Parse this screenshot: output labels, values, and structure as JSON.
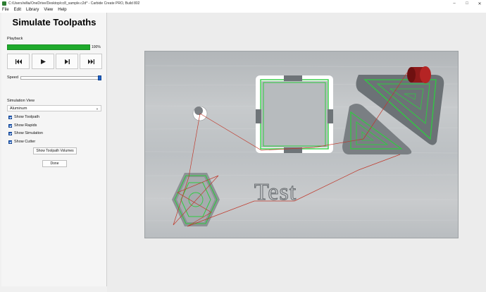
{
  "window": {
    "title": "C:/Users/wllia/OneDrive/Desktop/cc8_sample.c2d* - Carbide Create PRO, Build 802",
    "controls": [
      "–",
      "□",
      "✕"
    ]
  },
  "menu": {
    "items": [
      "File",
      "Edit",
      "Library",
      "View",
      "Help"
    ]
  },
  "panel": {
    "title": "Simulate Toolpaths",
    "playback_label": "Playback",
    "progress": {
      "value": 1.0,
      "label": "100%"
    },
    "controls": {
      "rewind_icon": "skip-to-start-icon",
      "play_icon": "play-icon",
      "step_icon": "step-forward-icon",
      "end_icon": "skip-to-end-icon"
    },
    "speed_label": "Speed",
    "speed_value": 1.0,
    "simulation_view_label": "Simulation View",
    "material_selected": "Aluminum",
    "checkboxes": [
      {
        "label": "Show Toolpath",
        "checked": true
      },
      {
        "label": "Show Rapids",
        "checked": true
      },
      {
        "label": "Show Simulation",
        "checked": true
      },
      {
        "label": "Show Cutter",
        "checked": true
      }
    ],
    "show_volumes_button": "Show Toolpath Volumes",
    "done_button": "Done"
  },
  "canvas": {
    "engraved_text": "Test",
    "colors": {
      "accent_blue": "#1e62c9",
      "progress_green": "#1faa2c",
      "toolpath_green": "#2ecc40",
      "rapid_red": "#c0392b",
      "cutter_red": "#9b1c1c"
    }
  }
}
